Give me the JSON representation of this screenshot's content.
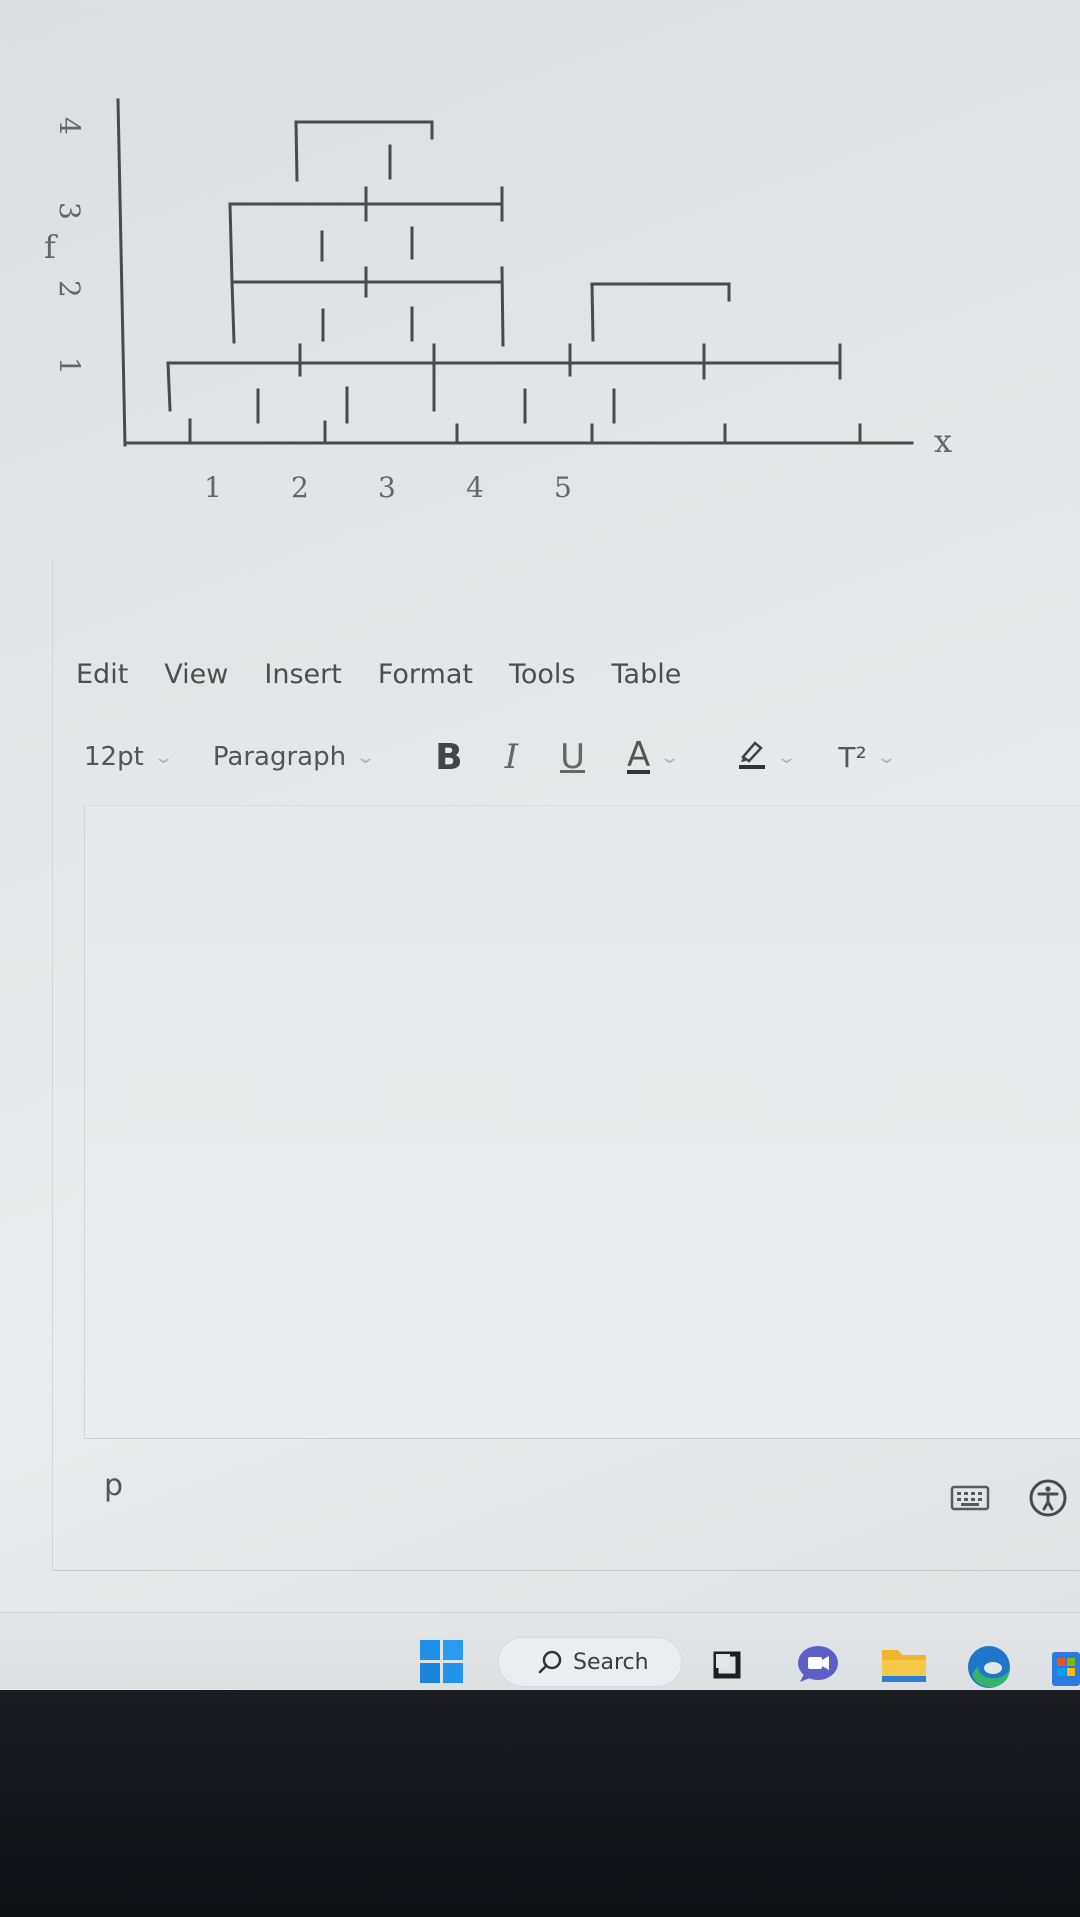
{
  "figure": {
    "axis_x_label": "x",
    "axis_y_label": "f",
    "x_ticks": [
      "1",
      "2",
      "3",
      "4",
      "5"
    ],
    "y_ticks": [
      "1",
      "2",
      "3",
      "4"
    ]
  },
  "menubar": {
    "items": [
      "Edit",
      "View",
      "Insert",
      "Format",
      "Tools",
      "Table"
    ]
  },
  "toolbar": {
    "font_size": "12pt",
    "block_format": "Paragraph",
    "bold": "B",
    "italic": "I",
    "underline": "U",
    "text_color": "A",
    "superscript": "T²"
  },
  "statusbar": {
    "path": "p"
  },
  "taskbar": {
    "search_label": "Search"
  },
  "colors": {
    "accent_windows": "#1f8fe8",
    "edge_blue": "#1c76c9",
    "edge_green": "#33b36b",
    "folder_yellow": "#f2b42a",
    "teams_purple": "#5b5fc7"
  }
}
